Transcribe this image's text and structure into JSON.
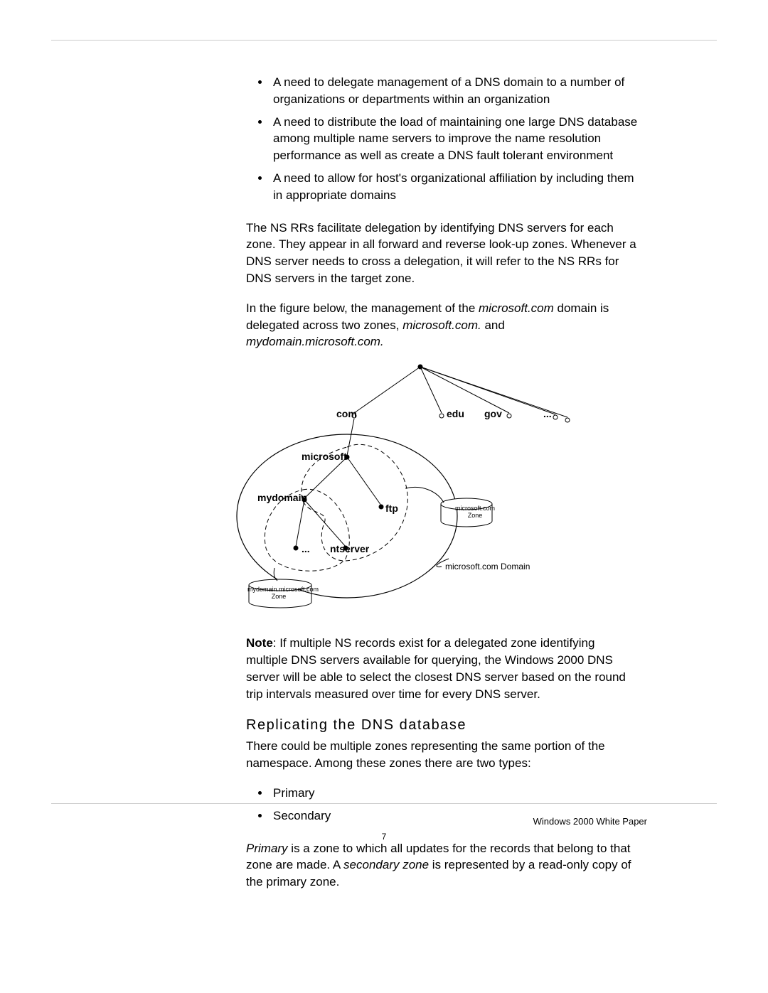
{
  "bullets_top": [
    "A need to delegate management of a DNS domain to a number of organizations or departments within an organization",
    "A need to distribute the load of maintaining one large DNS database among multiple name servers to improve the name resolution performance as well as create a DNS fault tolerant environment",
    "A need to allow for host's organizational affiliation by including them in appropriate domains"
  ],
  "para_ns": "The NS RRs facilitate delegation by identifying DNS servers for each zone. They appear in all forward and reverse look-up zones. Whenever a DNS server needs to cross a delegation, it will refer to the NS RRs for DNS servers in the target zone.",
  "para_fig_a": "In the figure below, the management of the ",
  "para_fig_dom1": "microsoft.com",
  "para_fig_b": " domain is delegated across two zones, ",
  "para_fig_dom2": "microsoft.com.",
  "para_fig_c": " and ",
  "para_fig_dom3": "mydomain.microsoft.com.",
  "note_label": "Note",
  "note_text": ": If multiple NS records exist for a delegated zone identifying multiple DNS servers available for querying, the Windows 2000 DNS server will be able to select the closest DNS server based on the round trip intervals measured over time for every DNS server.",
  "section_title": "Replicating the DNS database",
  "para_rep": "There could be multiple zones representing the same portion of the namespace. Among these zones there are two types:",
  "bullets_types": [
    "Primary",
    "Secondary"
  ],
  "para_primary_a": "Primary",
  "para_primary_b": " is a zone to which all updates for the records that belong to that zone are made. A ",
  "para_primary_c": "secondary zone",
  "para_primary_d": " is represented by a read-only copy of the primary zone.",
  "diagram": {
    "tld_com": "com",
    "tld_edu": "edu",
    "tld_gov": "gov",
    "tld_etc": "...",
    "microsoft": "microsoft",
    "mydomain": "mydomain",
    "ftp": "ftp",
    "etc": "...",
    "ntserver": "ntserver",
    "zone1": "microsoft.com Zone",
    "zone2": "mydomain.microsoft.com Zone",
    "domain_caption": "microsoft.com Domain"
  },
  "footer_title": "Windows 2000 White Paper",
  "footer_page": "7"
}
